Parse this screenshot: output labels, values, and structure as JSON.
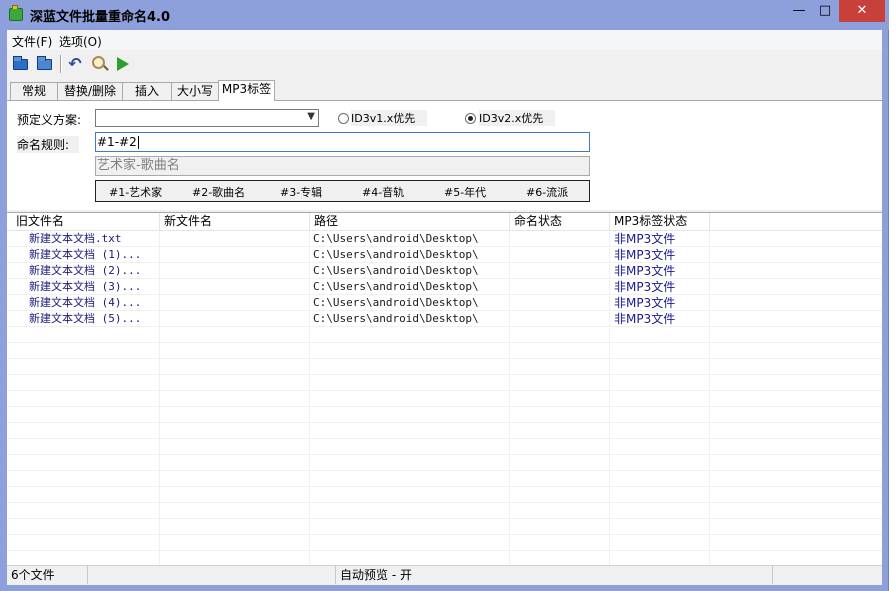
{
  "window": {
    "title": "深蓝文件批量重命名4.0",
    "minimize_glyph": "—",
    "maximize_glyph": "□",
    "close_glyph": "✕"
  },
  "menu": [
    {
      "label": "文件(F)"
    },
    {
      "label": "选项(O)"
    }
  ],
  "toolbar": {
    "icons": [
      "open-folder-icon",
      "open-folder-icon",
      "undo-icon",
      "preview-search-icon",
      "run-icon"
    ]
  },
  "tabs": [
    {
      "label": "常规"
    },
    {
      "label": "替换/删除"
    },
    {
      "label": "插入"
    },
    {
      "label": "大小写"
    },
    {
      "label": "MP3标签",
      "active": true
    }
  ],
  "mp3_panel": {
    "preset_label": "预定义方案:",
    "preset_value": "",
    "radio_v1_label": "ID3v1.x优先",
    "radio_v2_label": "ID3v2.x优先",
    "selected_radio": "v2",
    "rule_label": "命名规则:",
    "rule_value": "#1-#2",
    "preview_value": "艺术家-歌曲名",
    "tags": [
      "#1-艺术家",
      "#2-歌曲名",
      "#3-专辑",
      "#4-音轨",
      "#5-年代",
      "#6-流派"
    ]
  },
  "list": {
    "columns": [
      "旧文件名",
      "新文件名",
      "路径",
      "命名状态",
      "MP3标签状态"
    ],
    "rows": [
      {
        "old": "新建文本文档.txt",
        "new": "",
        "path": "C:\\Users\\android\\Desktop\\",
        "status": "",
        "mp3": "非MP3文件"
      },
      {
        "old": "新建文本文档 (1)...",
        "new": "",
        "path": "C:\\Users\\android\\Desktop\\",
        "status": "",
        "mp3": "非MP3文件"
      },
      {
        "old": "新建文本文档 (2)...",
        "new": "",
        "path": "C:\\Users\\android\\Desktop\\",
        "status": "",
        "mp3": "非MP3文件"
      },
      {
        "old": "新建文本文档 (3)...",
        "new": "",
        "path": "C:\\Users\\android\\Desktop\\",
        "status": "",
        "mp3": "非MP3文件"
      },
      {
        "old": "新建文本文档 (4)...",
        "new": "",
        "path": "C:\\Users\\android\\Desktop\\",
        "status": "",
        "mp3": "非MP3文件"
      },
      {
        "old": "新建文本文档 (5)...",
        "new": "",
        "path": "C:\\Users\\android\\Desktop\\",
        "status": "",
        "mp3": "非MP3文件"
      }
    ]
  },
  "status": {
    "file_count": "6个文件",
    "middle": "",
    "auto_preview": "自动预览 - 开"
  }
}
